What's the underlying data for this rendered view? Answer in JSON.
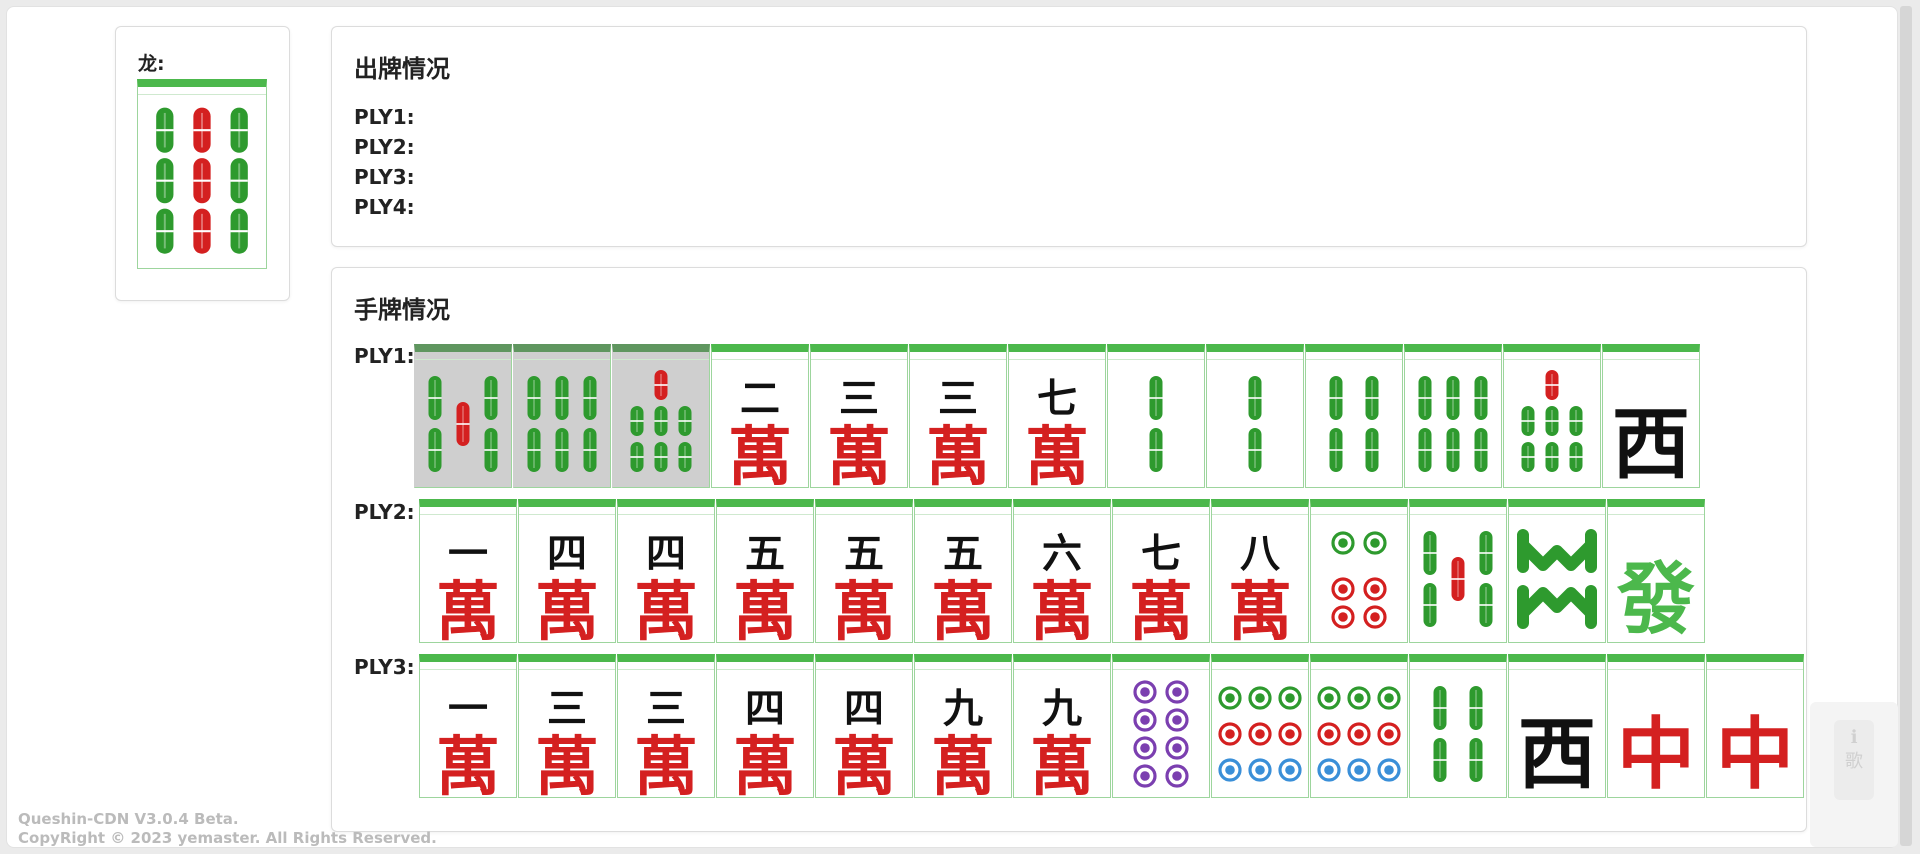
{
  "dragon_panel": {
    "label": "龙:",
    "tile": "bamboo-9-red-center"
  },
  "discard": {
    "title": "出牌情况",
    "players": [
      "PLY1:",
      "PLY2:",
      "PLY3:",
      "PLY4:"
    ]
  },
  "hands": {
    "title": "手牌情况",
    "ply1": {
      "label": "PLY1:",
      "tiles": [
        {
          "kind": "bamboo",
          "rank": 5,
          "selected": true
        },
        {
          "kind": "bamboo",
          "rank": 6,
          "selected": true
        },
        {
          "kind": "bamboo",
          "rank": 7,
          "selected": true
        },
        {
          "kind": "wan",
          "num": "二"
        },
        {
          "kind": "wan",
          "num": "三"
        },
        {
          "kind": "wan",
          "num": "三"
        },
        {
          "kind": "wan",
          "num": "七"
        },
        {
          "kind": "bamboo",
          "rank": 2
        },
        {
          "kind": "bamboo",
          "rank": 2
        },
        {
          "kind": "bamboo",
          "rank": 4
        },
        {
          "kind": "bamboo",
          "rank": 6
        },
        {
          "kind": "bamboo",
          "rank": 7
        },
        {
          "kind": "honor",
          "glyph": "西",
          "color": "#111111"
        }
      ]
    },
    "ply2": {
      "label": "PLY2:",
      "tiles": [
        {
          "kind": "wan",
          "num": "一"
        },
        {
          "kind": "wan",
          "num": "四"
        },
        {
          "kind": "wan",
          "num": "四"
        },
        {
          "kind": "wan",
          "num": "五"
        },
        {
          "kind": "wan",
          "num": "五"
        },
        {
          "kind": "wan",
          "num": "五"
        },
        {
          "kind": "wan",
          "num": "六"
        },
        {
          "kind": "wan",
          "num": "七"
        },
        {
          "kind": "wan",
          "num": "八"
        },
        {
          "kind": "dots",
          "rank": 6
        },
        {
          "kind": "bamboo",
          "rank": 5
        },
        {
          "kind": "bamboo",
          "rank": 8
        },
        {
          "kind": "honor",
          "glyph": "發",
          "color": "#4cb84c"
        }
      ]
    },
    "ply3": {
      "label": "PLY3:",
      "tiles": [
        {
          "kind": "wan",
          "num": "一"
        },
        {
          "kind": "wan",
          "num": "三"
        },
        {
          "kind": "wan",
          "num": "三"
        },
        {
          "kind": "wan",
          "num": "四"
        },
        {
          "kind": "wan",
          "num": "四"
        },
        {
          "kind": "wan",
          "num": "九"
        },
        {
          "kind": "wan",
          "num": "九"
        },
        {
          "kind": "dots",
          "rank": 8
        },
        {
          "kind": "dots",
          "rank": 9
        },
        {
          "kind": "dots",
          "rank": 9
        },
        {
          "kind": "bamboo",
          "rank": 4
        },
        {
          "kind": "honor",
          "glyph": "西",
          "color": "#111111"
        },
        {
          "kind": "honor",
          "glyph": "中",
          "color": "#d42020"
        },
        {
          "kind": "honor",
          "glyph": "中",
          "color": "#d42020"
        }
      ]
    }
  },
  "footer": {
    "line1": "Queshin-CDN V3.0.4 Beta.",
    "line2": "CopyRight © 2023 yemaster. All Rights Reserved."
  },
  "side_widget": {
    "icon": "info-icon",
    "text": "歌"
  },
  "colors": {
    "green": "#2e9a2e",
    "red": "#d42020",
    "blue": "#3a8fd8",
    "purple": "#7b3fb0",
    "tile_top": "#4cb84c"
  }
}
